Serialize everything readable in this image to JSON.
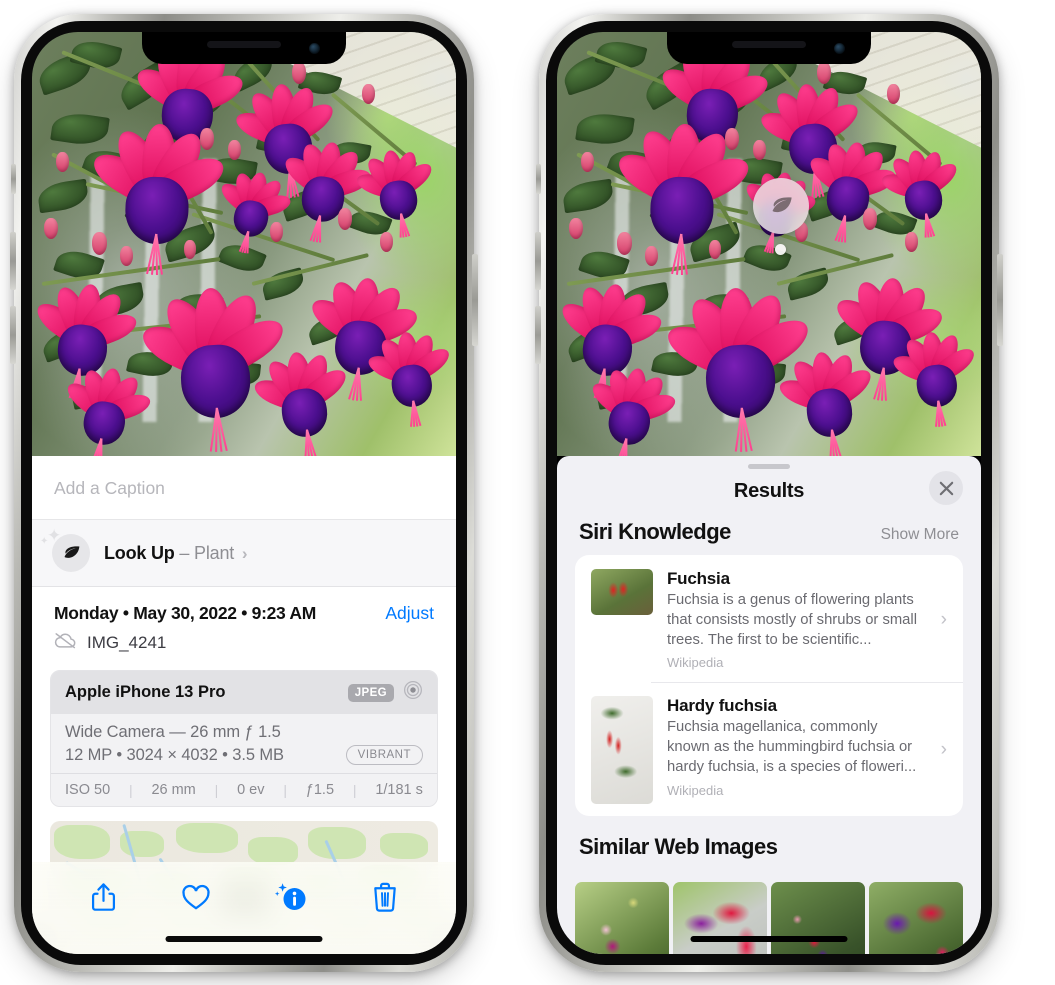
{
  "left_phone": {
    "caption": {
      "value": "",
      "placeholder": "Add a Caption"
    },
    "lookup": {
      "label": "Look Up",
      "dash": "–",
      "subject": "Plant",
      "chevron": "›",
      "icon": "leaf-icon"
    },
    "meta": {
      "date": "Monday • May 30, 2022 • 9:23 AM",
      "adjust_label": "Adjust",
      "filename": "IMG_4241",
      "cloud_icon": "icloud-slash-icon"
    },
    "exif": {
      "device": "Apple iPhone 13 Pro",
      "format_badge": "JPEG",
      "lens_icon": "aperture-icon",
      "lens_line": "Wide Camera — 26 mm ƒ 1.5",
      "size_line": "12 MP • 3024 × 4032 • 3.5 MB",
      "style_badge": "VIBRANT",
      "stats": [
        "ISO 50",
        "26 mm",
        "0 ev",
        "ƒ1.5",
        "1/181 s"
      ],
      "divider": "|"
    },
    "toolbar": [
      {
        "name": "share-button",
        "icon": "share-icon"
      },
      {
        "name": "favorite-button",
        "icon": "heart-icon"
      },
      {
        "name": "info-button",
        "icon": "info-sparkle-icon"
      },
      {
        "name": "delete-button",
        "icon": "trash-icon"
      }
    ]
  },
  "right_phone": {
    "visual_lookup_badge": {
      "icon": "leaf-icon"
    },
    "sheet": {
      "title": "Results",
      "close_icon": "close-icon",
      "sections": [
        {
          "title": "Siri Knowledge",
          "action": "Show More",
          "items": [
            {
              "name": "Fuchsia",
              "description": "Fuchsia is a genus of flowering plants that consists mostly of shrubs or small trees. The first to be scientific...",
              "source": "Wikipedia",
              "chevron": "›",
              "thumb": "fuchsia-red-thumbnail"
            },
            {
              "name": "Hardy fuchsia",
              "description": "Fuchsia magellanica, commonly known as the hummingbird fuchsia or hardy fuchsia, is a species of floweri...",
              "source": "Wikipedia",
              "chevron": "›",
              "thumb": "hardy-fuchsia-thumbnail"
            }
          ]
        },
        {
          "title": "Similar Web Images",
          "thumbnails": [
            "fuchsia-web-image-1",
            "fuchsia-web-image-2",
            "fuchsia-web-image-3",
            "fuchsia-web-image-4"
          ]
        }
      ]
    }
  },
  "colors": {
    "accent_blue": "#007aff",
    "sheet_bg": "#f1f1f5",
    "card_bg": "#ffffff",
    "secondary_text": "#8e8e93"
  }
}
